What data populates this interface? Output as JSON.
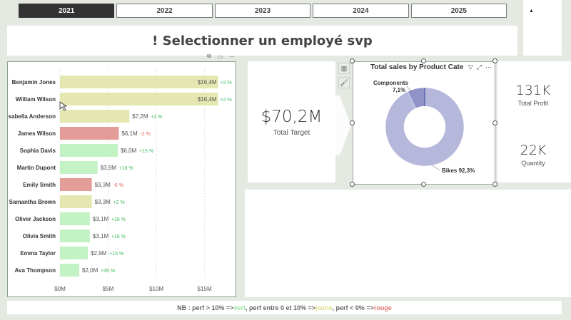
{
  "years": [
    "2021",
    "2022",
    "2023",
    "2024",
    "2025"
  ],
  "selected_year": "2021",
  "page_title": "! Selectionner un employé svp",
  "bar_chart": {
    "header_icons": [
      "pin-icon",
      "focus-icon",
      "more-icon"
    ],
    "header_glyphs": [
      "⧉",
      "▭",
      "⋯"
    ]
  },
  "chart_data": [
    {
      "type": "bar",
      "orientation": "horizontal",
      "categories": [
        "Benjamin Jones",
        "William Wilson",
        "Isabella Anderson",
        "James Wilson",
        "Sophia Davis",
        "Martin Dupont",
        "Emily Smith",
        "Samantha Brown",
        "Oliver Jackson",
        "Olivia Smith",
        "Emma Taylor",
        "Ava Thompson"
      ],
      "values": [
        16.4,
        16.4,
        7.2,
        6.1,
        6.0,
        3.9,
        3.3,
        3.3,
        3.1,
        3.1,
        2.9,
        2.0
      ],
      "value_labels": [
        "$16,4M",
        "$16,4M",
        "$7,2M",
        "$6,1M",
        "$6,0M",
        "$3,9M",
        "$3,3M",
        "$3,3M",
        "$3,1M",
        "$3,1M",
        "$2,9M",
        "$2,0M"
      ],
      "perf_labels": [
        "+2 %",
        "+2 %",
        "+2 %",
        "-2 %",
        "+15 %",
        "+16 %",
        "-6 %",
        "+2 %",
        "+16 %",
        "+16 %",
        "+15 %",
        "+35 %"
      ],
      "perf_values": [
        2,
        2,
        2,
        -2,
        15,
        16,
        -6,
        2,
        16,
        16,
        15,
        35
      ],
      "xticks": [
        0,
        5,
        10,
        15
      ],
      "xtick_labels": [
        "$0M",
        "$5M",
        "$10M",
        "$15M"
      ],
      "xlim": [
        0,
        16.8
      ],
      "grid": true,
      "colors": {
        "green": "#c3f2c5",
        "yellow": "#e5e7b0",
        "red": "#e39c97"
      }
    },
    {
      "type": "pie",
      "donut": true,
      "title": "Total sales by Product Cate",
      "categories": [
        "Bikes",
        "Components"
      ],
      "values": [
        92.3,
        7.1
      ],
      "labels": [
        "Bikes 92,3%",
        "Components",
        "7,1%"
      ],
      "colors": [
        "#b5b8db",
        "#8f93c8"
      ]
    }
  ],
  "cards": {
    "total_target": {
      "value": "$70,2M",
      "label": "Total Target"
    },
    "total_profit": {
      "value": "131K",
      "label": "Total Profit"
    },
    "quantity": {
      "value": "22K",
      "label": "Quantity"
    }
  },
  "donut_tools": [
    "▽",
    "⤢",
    "⋯"
  ],
  "side_tools": [
    "▥",
    "🖌"
  ],
  "note": {
    "prefix": "NB : perf > 10% => ",
    "green": "vert",
    "middle": ", perf entre 0 et 10% => ",
    "yellow": "jaune",
    "middle2": ", perf < 0% => ",
    "red": "rouge"
  }
}
